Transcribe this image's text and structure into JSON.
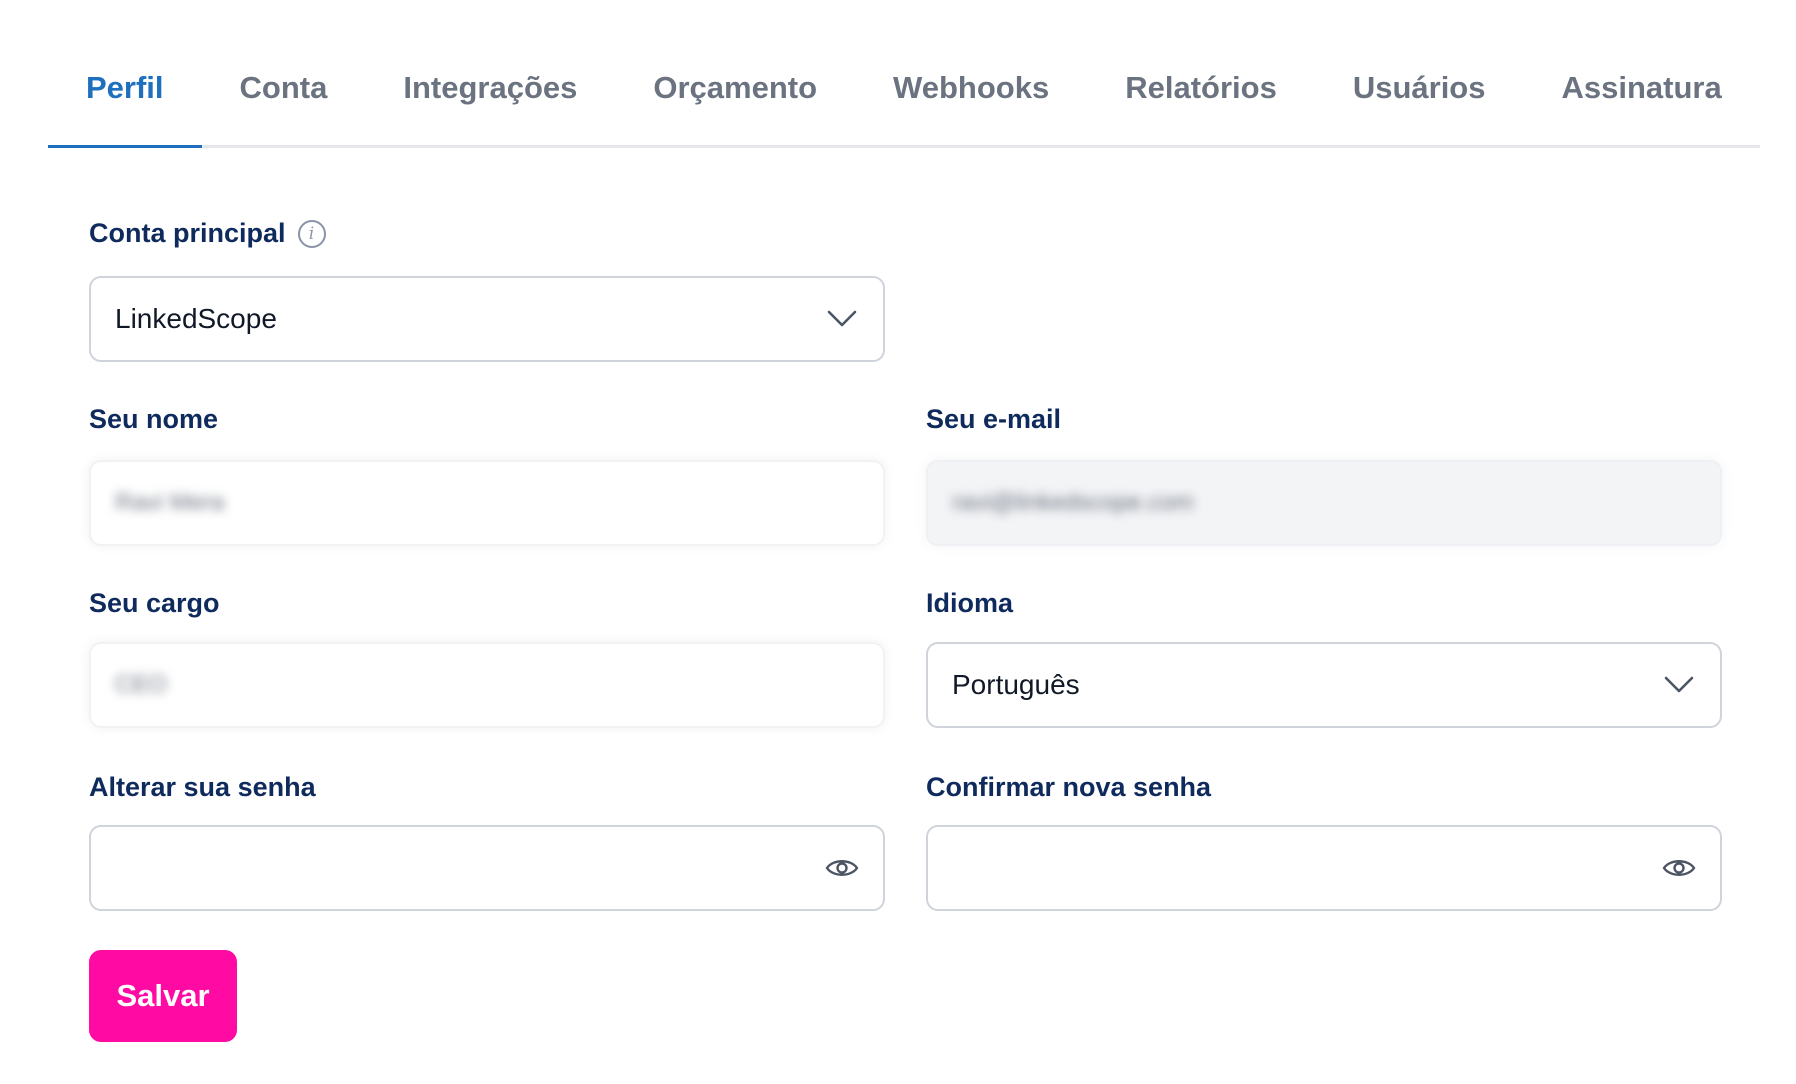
{
  "tabs": [
    {
      "label": "Perfil",
      "active": true
    },
    {
      "label": "Conta",
      "active": false
    },
    {
      "label": "Integrações",
      "active": false
    },
    {
      "label": "Orçamento",
      "active": false
    },
    {
      "label": "Webhooks",
      "active": false
    },
    {
      "label": "Relatórios",
      "active": false
    },
    {
      "label": "Usuários",
      "active": false
    },
    {
      "label": "Assinatura",
      "active": false
    }
  ],
  "form": {
    "main_account": {
      "label": "Conta principal",
      "value": "LinkedScope",
      "icon": "info-icon"
    },
    "name": {
      "label": "Seu nome",
      "value": "Ravi Mera"
    },
    "email": {
      "label": "Seu e-mail",
      "value": "ravi@linkedscope.com"
    },
    "role": {
      "label": "Seu cargo",
      "value": "CEO"
    },
    "language": {
      "label": "Idioma",
      "value": "Português"
    },
    "new_password": {
      "label": "Alterar sua senha",
      "value": "",
      "icon": "eye-icon"
    },
    "confirm_password": {
      "label": "Confirmar nova senha",
      "value": "",
      "icon": "eye-icon"
    },
    "save_label": "Salvar"
  },
  "colors": {
    "accent": "#1f6fbf",
    "label": "#0f2a5c",
    "inactive_tab": "#6b7280",
    "save_button": "#ff0aa3"
  }
}
